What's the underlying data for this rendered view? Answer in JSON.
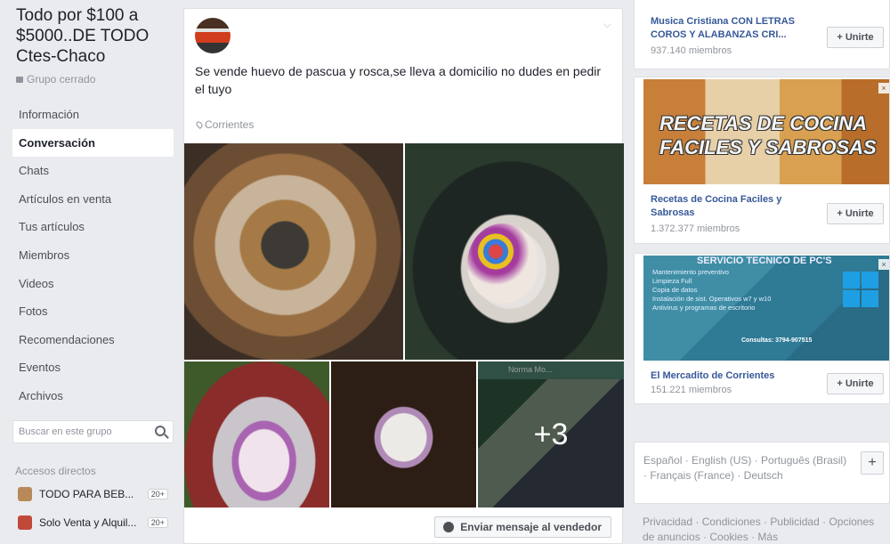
{
  "group": {
    "title": "Todo por $100 a $5000..DE TODO Ctes-Chaco",
    "type": "Grupo cerrado"
  },
  "nav": {
    "items": [
      "Información",
      "Conversación",
      "Chats",
      "Artículos en venta",
      "Tus artículos",
      "Miembros",
      "Videos",
      "Fotos",
      "Recomendaciones",
      "Eventos",
      "Archivos"
    ],
    "active": "Conversación"
  },
  "search": {
    "placeholder": "Buscar en este grupo"
  },
  "shortcuts": {
    "heading": "Accesos directos",
    "items": [
      {
        "label": "TODO PARA BEB...",
        "count": "20+"
      },
      {
        "label": "Solo Venta y Alquil...",
        "count": "20+"
      }
    ]
  },
  "post": {
    "text": "Se vende huevo de pascua y rosca,se lleva a domicilio no dudes en pedir el tuyo",
    "location": "Corrientes",
    "more_photos": "+3",
    "thumb_header": "Norma Mo...",
    "message_button": "Enviar mensaje al vendedor"
  },
  "suggestions": [
    {
      "title": "Musica Cristiana CON LETRAS COROS Y ALABANZAS CRI...",
      "members": "937.140 miembros",
      "join": "+ Unirte"
    },
    {
      "image_text": "RECETAS DE COCINA FACILES Y SABROSAS",
      "title": "Recetas de Cocina Faciles y Sabrosas",
      "members": "1.372.377 miembros",
      "join": "+ Unirte"
    },
    {
      "image_title": "SERVICIO TECNICO DE PC'S",
      "image_lines": [
        "Mantenimiento preventivo",
        "Limpieza Full",
        "Copia de datos",
        "Instalación de sist. Operativos w7 y w10",
        "Antivirus y programas de escritorio"
      ],
      "image_phone": "Consultas: 3794-907515",
      "title": "El Mercadito de Corrientes",
      "members": "151.221 miembros",
      "join": "+ Unirte"
    }
  ],
  "languages": {
    "text": "Español · English (US) · Português (Brasil) · Français (France) · Deutsch",
    "add": "+"
  },
  "footer": {
    "text": "Privacidad · Condiciones · Publicidad · Opciones de anuncios · Cookies · Más"
  }
}
